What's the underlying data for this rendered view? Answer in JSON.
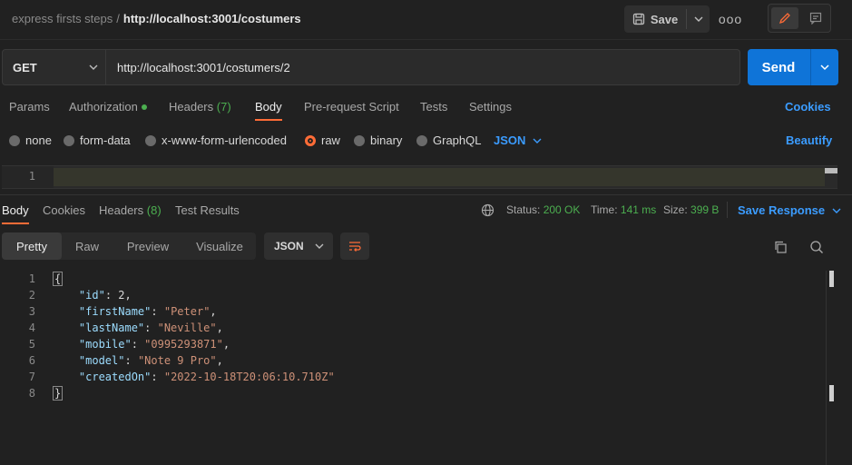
{
  "header": {
    "collection": "express firsts steps",
    "separator": "/",
    "request_name": "http://localhost:3001/costumers",
    "save_label": "Save",
    "more_label": "ooo"
  },
  "request": {
    "method": "GET",
    "url": "http://localhost:3001/costumers/2",
    "send_label": "Send"
  },
  "request_tabs": {
    "params": "Params",
    "authorization": "Authorization",
    "headers": "Headers",
    "headers_count": "(7)",
    "body": "Body",
    "prerequest": "Pre-request Script",
    "tests": "Tests",
    "settings": "Settings",
    "cookies": "Cookies"
  },
  "body_types": {
    "none": "none",
    "form_data": "form-data",
    "urlencoded": "x-www-form-urlencoded",
    "raw": "raw",
    "binary": "binary",
    "graphql": "GraphQL",
    "selected": "raw",
    "language": "JSON",
    "beautify": "Beautify"
  },
  "editor": {
    "line_number": "1"
  },
  "response_tabs": {
    "body": "Body",
    "cookies": "Cookies",
    "headers": "Headers",
    "headers_count": "(8)",
    "test_results": "Test Results"
  },
  "response_meta": {
    "status_label": "Status:",
    "status_value": "200 OK",
    "time_label": "Time:",
    "time_value": "141 ms",
    "size_label": "Size:",
    "size_value": "399 B",
    "save_response": "Save Response"
  },
  "view_modes": {
    "pretty": "Pretty",
    "raw": "Raw",
    "preview": "Preview",
    "visualize": "Visualize",
    "format": "JSON"
  },
  "response_body": {
    "line_numbers": [
      "1",
      "2",
      "3",
      "4",
      "5",
      "6",
      "7",
      "8"
    ],
    "open_brace": "{",
    "close_brace": "}",
    "fields": [
      {
        "key": "\"id\"",
        "value": "2",
        "type": "number",
        "comma": ","
      },
      {
        "key": "\"firstName\"",
        "value": "\"Peter\"",
        "type": "string",
        "comma": ","
      },
      {
        "key": "\"lastName\"",
        "value": "\"Neville\"",
        "type": "string",
        "comma": ","
      },
      {
        "key": "\"mobile\"",
        "value": "\"0995293871\"",
        "type": "string",
        "comma": ","
      },
      {
        "key": "\"model\"",
        "value": "\"Note 9 Pro\"",
        "type": "string",
        "comma": ","
      },
      {
        "key": "\"createdOn\"",
        "value": "\"2022-10-18T20:06:10.710Z\"",
        "type": "string",
        "comma": ""
      }
    ]
  },
  "colors": {
    "accent": "#ff6c37",
    "link": "#3b9cff",
    "send": "#0f74d8",
    "success": "#4caf50"
  },
  "icons": [
    "save-icon",
    "chevron-down-icon",
    "more-icon",
    "edit-icon",
    "comment-icon",
    "globe-icon",
    "wrap-lines-icon",
    "copy-icon",
    "search-icon"
  ]
}
